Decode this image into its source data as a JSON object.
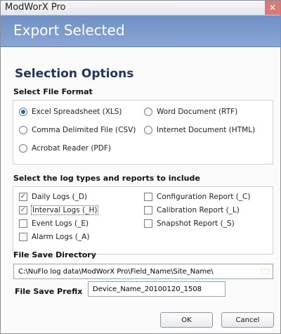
{
  "window": {
    "title": "ModWorX Pro",
    "close_icon": "close-icon"
  },
  "header": {
    "title": "Export Selected"
  },
  "selection_options": {
    "title": "Selection Options"
  },
  "file_format": {
    "label": "Select File Format",
    "options": [
      {
        "label": "Excel Spreadsheet (XLS)",
        "selected": true
      },
      {
        "label": "Word Document (RTF)",
        "selected": false
      },
      {
        "label": "Comma Delimited File (CSV)",
        "selected": false
      },
      {
        "label": "Internet Document (HTML)",
        "selected": false
      },
      {
        "label": "Acrobat Reader (PDF)",
        "selected": false
      }
    ]
  },
  "log_types": {
    "label": "Select the log types and reports to include",
    "items": [
      {
        "label": "Daily Logs (_D)",
        "checked": true
      },
      {
        "label": "Configuration Report (_C)",
        "checked": false
      },
      {
        "label": "Interval Logs (_H)",
        "checked": true
      },
      {
        "label": "Calibration Report (_L)",
        "checked": false
      },
      {
        "label": "Event Logs (_E)",
        "checked": false
      },
      {
        "label": "Snapshot Report (_S)",
        "checked": false
      },
      {
        "label": "Alarm Logs (_A)",
        "checked": false
      }
    ]
  },
  "directory": {
    "label": "File Save Directory",
    "value": "C:\\NuFlo log data\\ModWorX Pro\\Field_Name\\Site_Name\\",
    "folder_icon": "folder-icon"
  },
  "prefix": {
    "label": "File Save Prefix",
    "value": "Device_Name_20100120_1508"
  },
  "buttons": {
    "ok": "OK",
    "cancel": "Cancel"
  }
}
